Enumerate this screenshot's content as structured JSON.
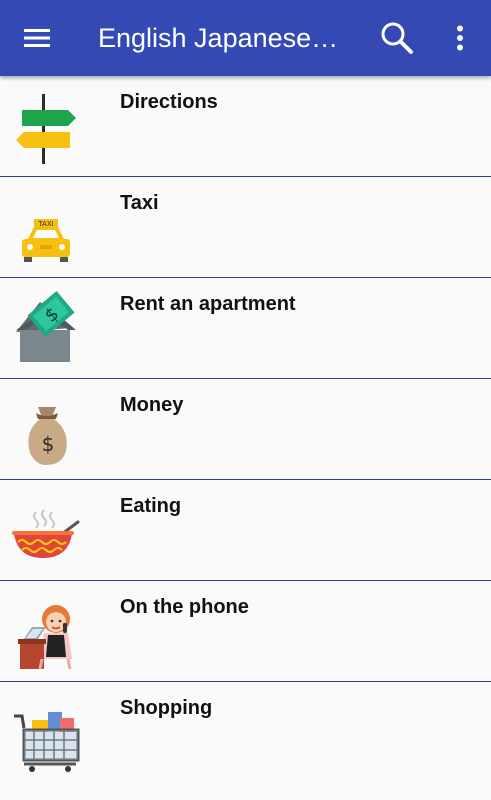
{
  "appbar": {
    "title": "English Japanese…",
    "menu_icon": "hamburger-menu-icon",
    "search_icon": "search-icon",
    "overflow_icon": "more-vert-icon",
    "color": "#3549b5"
  },
  "categories": [
    {
      "label": "Directions",
      "icon": "signpost-icon"
    },
    {
      "label": "Taxi",
      "icon": "taxi-icon"
    },
    {
      "label": "Rent an apartment",
      "icon": "house-money-icon"
    },
    {
      "label": "Money",
      "icon": "money-bag-icon"
    },
    {
      "label": "Eating",
      "icon": "food-bowl-icon"
    },
    {
      "label": "On the phone",
      "icon": "woman-phone-icon"
    },
    {
      "label": "Shopping",
      "icon": "shopping-cart-icon"
    }
  ]
}
